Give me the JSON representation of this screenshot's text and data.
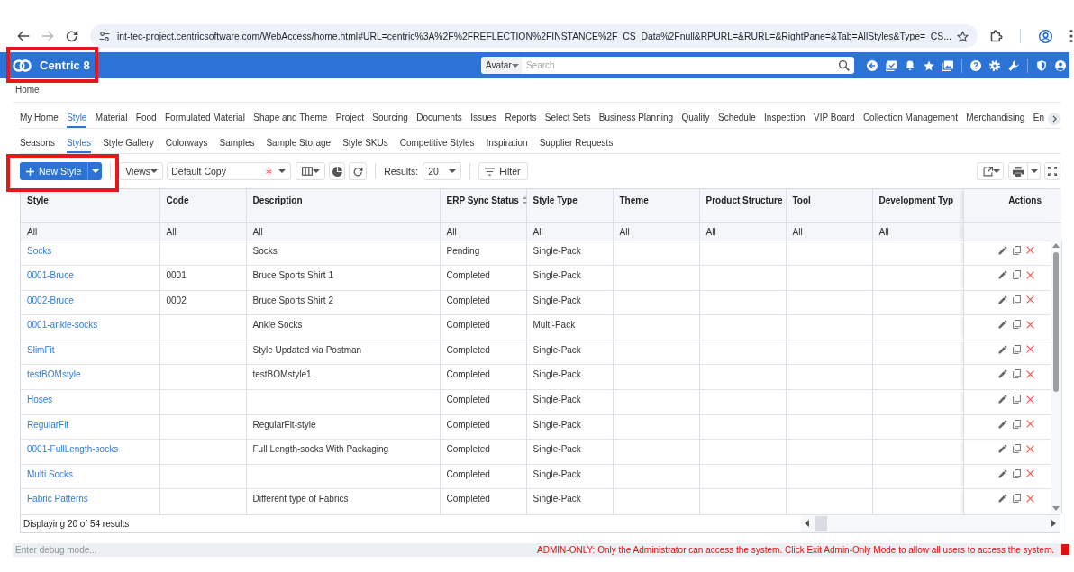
{
  "browser": {
    "nav_buttons": [
      {
        "kind": "back",
        "disabled": false
      },
      {
        "kind": "forward",
        "disabled": true
      },
      {
        "kind": "reload",
        "disabled": false
      }
    ],
    "url": "int-tec-project.centricsoftware.com/WebAccess/home.html#URL=centric%3A%2F%2FREFLECTION%2FINSTANCE%2F_CS_Data%2Fnull&RPURL=&RURL=&RightPane=&Tab=AllStyles&Type=_CS..."
  },
  "app_bar": {
    "logo": {
      "text": "Centric 8",
      "highlighted": true
    },
    "search": {
      "scope": "Avatar",
      "placeholder": "Search"
    }
  },
  "breadcrumb": "Home",
  "module_tabs": [
    {
      "label": "My Home",
      "selected": false
    },
    {
      "label": "Style",
      "selected": true
    },
    {
      "label": "Material",
      "selected": false
    },
    {
      "label": "Food",
      "selected": false
    },
    {
      "label": "Formulated Material",
      "selected": false
    },
    {
      "label": "Shape and Theme",
      "selected": false
    },
    {
      "label": "Project",
      "selected": false
    },
    {
      "label": "Sourcing",
      "selected": false
    },
    {
      "label": "Documents",
      "selected": false
    },
    {
      "label": "Issues",
      "selected": false
    },
    {
      "label": "Reports",
      "selected": false
    },
    {
      "label": "Select Sets",
      "selected": false
    },
    {
      "label": "Business Planning",
      "selected": false
    },
    {
      "label": "Quality",
      "selected": false
    },
    {
      "label": "Schedule",
      "selected": false
    },
    {
      "label": "Inspection",
      "selected": false
    },
    {
      "label": "VIP Board",
      "selected": false
    },
    {
      "label": "Collection Management",
      "selected": false
    },
    {
      "label": "Merchandising",
      "selected": false
    },
    {
      "label": "En",
      "selected": false
    }
  ],
  "sub_tabs": [
    {
      "label": "Seasons",
      "selected": false
    },
    {
      "label": "Styles",
      "selected": true
    },
    {
      "label": "Style Gallery",
      "selected": false
    },
    {
      "label": "Colorways",
      "selected": false
    },
    {
      "label": "Samples",
      "selected": false
    },
    {
      "label": "Sample Storage",
      "selected": false
    },
    {
      "label": "Style SKUs",
      "selected": false
    },
    {
      "label": "Competitive Styles",
      "selected": false
    },
    {
      "label": "Inspiration",
      "selected": false
    },
    {
      "label": "Supplier Requests",
      "selected": false
    }
  ],
  "toolbar": {
    "new_button": {
      "label": "New Style",
      "highlighted": true
    },
    "views_button": "Views",
    "view_select": {
      "value": "Default Copy",
      "modified": true
    },
    "results_label": "Results:",
    "results_select": "20",
    "filter_button": "Filter"
  },
  "table": {
    "columns": [
      {
        "label": "Style",
        "sortable": false
      },
      {
        "label": "Code",
        "sortable": false
      },
      {
        "label": "Description",
        "sortable": false
      },
      {
        "label": "ERP Sync Status",
        "sortable": true
      },
      {
        "label": "Style Type",
        "sortable": false
      },
      {
        "label": "Theme",
        "sortable": false
      },
      {
        "label": "Product Structure",
        "sortable": false
      },
      {
        "label": "Tool",
        "sortable": false
      },
      {
        "label": "Development Typ",
        "sortable": false
      }
    ],
    "actions_header": "Actions",
    "filters": [
      "All",
      "All",
      "All",
      "All",
      "All",
      "All",
      "All",
      "All",
      "All"
    ],
    "rows": [
      {
        "style": "Socks",
        "description": "Socks",
        "erp_sync_status": "Pending",
        "style_type": "Single-Pack"
      },
      {
        "style": "0001-Bruce",
        "code": "0001",
        "description": "Bruce Sports Shirt 1",
        "erp_sync_status": "Completed",
        "style_type": "Single-Pack"
      },
      {
        "style": "0002-Bruce",
        "code": "0002",
        "description": "Bruce Sports Shirt 2",
        "erp_sync_status": "Completed",
        "style_type": "Single-Pack"
      },
      {
        "style": "0001-ankle-socks",
        "description": "Ankle Socks",
        "erp_sync_status": "Completed",
        "style_type": "Multi-Pack"
      },
      {
        "style": "SlimFit",
        "description": "Style Updated via Postman",
        "erp_sync_status": "Completed",
        "style_type": "Single-Pack"
      },
      {
        "style": "testBOMstyle",
        "description": "testBOMstyle1",
        "erp_sync_status": "Completed",
        "style_type": "Single-Pack"
      },
      {
        "style": "Hoses",
        "erp_sync_status": "Completed",
        "style_type": "Single-Pack"
      },
      {
        "style": "RegularFit",
        "description": "RegularFit-style",
        "erp_sync_status": "Completed",
        "style_type": "Single-Pack"
      },
      {
        "style": "0001-FullLength-socks",
        "description": "Full Length-socks With Packaging",
        "erp_sync_status": "Completed",
        "style_type": "Single-Pack"
      },
      {
        "style": "Multi Socks",
        "erp_sync_status": "Completed",
        "style_type": "Single-Pack"
      },
      {
        "style": "Fabric Patterns",
        "description": "Different type of Fabrics",
        "erp_sync_status": "Completed",
        "style_type": "Single-Pack"
      }
    ],
    "footer": "Displaying 20 of 54 results"
  },
  "status_bar": {
    "debug_placeholder": "Enter debug mode...",
    "message": "ADMIN-ONLY: Only the Administrator can access the system. Click Exit Admin-Only Mode to allow all users to access the system."
  }
}
